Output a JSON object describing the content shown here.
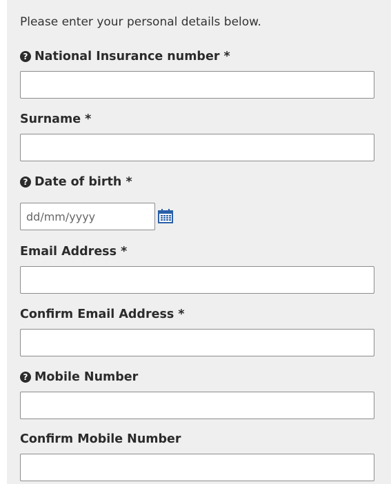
{
  "intro": "Please enter your personal details below.",
  "fields": [
    {
      "label": "National Insurance number *",
      "help": true,
      "value": ""
    },
    {
      "label": "Surname *",
      "help": false,
      "value": ""
    },
    {
      "label": "Date of birth *",
      "help": true,
      "value": "",
      "placeholder": "dd/mm/yyyy"
    },
    {
      "label": "Email Address *",
      "help": false,
      "value": ""
    },
    {
      "label": "Confirm Email Address *",
      "help": false,
      "value": ""
    },
    {
      "label": "Mobile Number",
      "help": true,
      "value": ""
    },
    {
      "label": "Confirm Mobile Number",
      "help": false,
      "value": ""
    }
  ],
  "icons": {
    "help": "question-circle-icon",
    "calendar": "calendar-icon"
  },
  "colors": {
    "panel": "#efefef",
    "help_icon": "#2b2b2b",
    "calendar_icon": "#2a5fa8"
  }
}
